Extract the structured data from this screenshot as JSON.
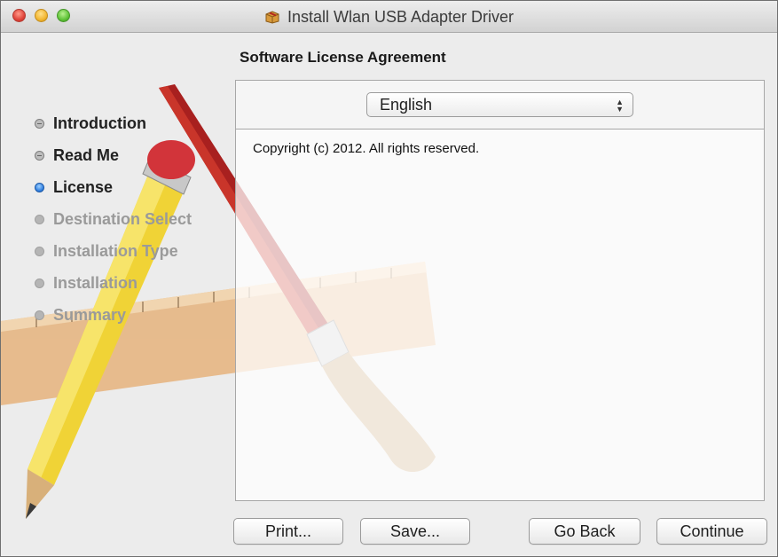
{
  "window": {
    "title": "Install Wlan USB Adapter Driver",
    "icon": "package-icon"
  },
  "page": {
    "heading": "Software License Agreement"
  },
  "sidebar": {
    "steps": [
      {
        "label": "Introduction",
        "state": "done"
      },
      {
        "label": "Read Me",
        "state": "done"
      },
      {
        "label": "License",
        "state": "current"
      },
      {
        "label": "Destination Select",
        "state": "future"
      },
      {
        "label": "Installation Type",
        "state": "future"
      },
      {
        "label": "Installation",
        "state": "future"
      },
      {
        "label": "Summary",
        "state": "future"
      }
    ]
  },
  "license": {
    "language": "English",
    "text": "Copyright (c) 2012.  All rights reserved."
  },
  "buttons": {
    "print": "Print...",
    "save": "Save...",
    "go_back": "Go Back",
    "continue": "Continue"
  },
  "colors": {
    "current_step": "#2f7ee0",
    "window_bg": "#ececec"
  }
}
